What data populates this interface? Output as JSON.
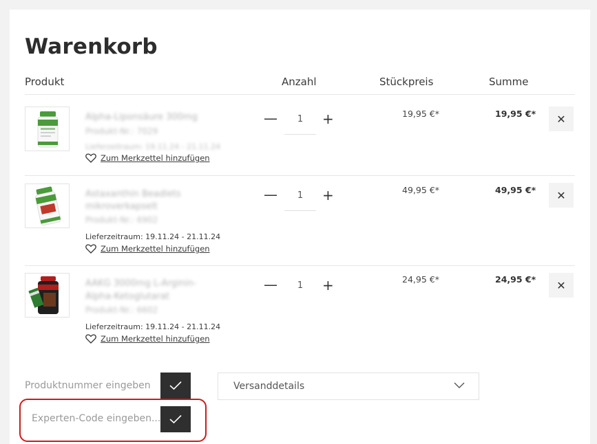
{
  "page": {
    "title": "Warenkorb"
  },
  "table": {
    "headers": {
      "product": "Produkt",
      "qty": "Anzahl",
      "unit_price": "Stückpreis",
      "sum": "Summe"
    }
  },
  "items": [
    {
      "name": "Alpha-Liponsäure 300mg",
      "name2": "",
      "product_no": "Produkt-Nr.: 7029",
      "delivery": "Lieferzeitraum: 19.11.24 - 21.11.24",
      "delivery_blurred": true,
      "wishlist": "Zum Merkzettel hinzufügen",
      "qty": "1",
      "unit_price": "19,95 €*",
      "total": "19,95 €*"
    },
    {
      "name": "Astaxanthin Beadlets",
      "name2": "mikroverkapselt",
      "product_no": "Produkt-Nr.: 6902",
      "delivery": "Lieferzeitraum: 19.11.24 - 21.11.24",
      "delivery_blurred": false,
      "wishlist": "Zum Merkzettel hinzufügen",
      "qty": "1",
      "unit_price": "49,95 €*",
      "total": "49,95 €*"
    },
    {
      "name": "AAKG 3000mg L-Arginin-",
      "name2": "Alpha-Ketoglutarat",
      "product_no": "Produkt-Nr.: 6602",
      "delivery": "Lieferzeitraum: 19.11.24 - 21.11.24",
      "delivery_blurred": false,
      "wishlist": "Zum Merkzettel hinzufügen",
      "qty": "1",
      "unit_price": "24,95 €*",
      "total": "24,95 €*"
    }
  ],
  "product_number": {
    "placeholder": "Produktnummer eingeben"
  },
  "expert_code": {
    "placeholder": "Experten-Code eingeben..."
  },
  "shipping": {
    "label": "Versanddetails"
  },
  "colors": {
    "accent_button": "#2f2f2f",
    "highlight": "#cc1b1b",
    "bottle_green": "#4a9b3a",
    "bottle_red": "#b01e1e"
  },
  "icons": {
    "remove": "close-icon",
    "wishlist": "heart-icon",
    "confirm": "check-icon",
    "dropdown": "chevron-down-icon"
  }
}
